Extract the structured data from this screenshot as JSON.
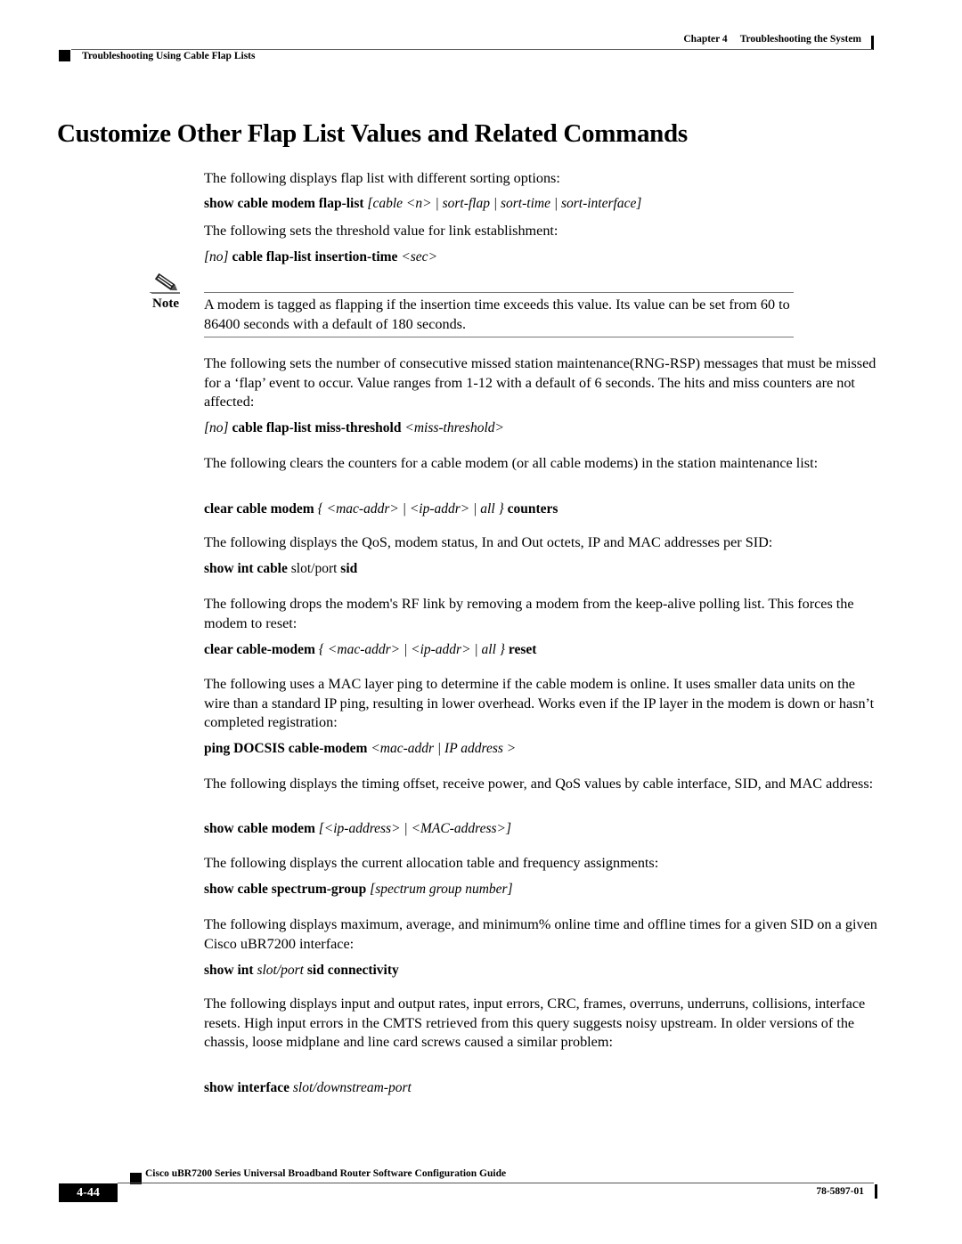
{
  "header": {
    "chapter_label": "Chapter 4",
    "chapter_title": "Troubleshooting the System",
    "section": "Troubleshooting Using Cable Flap Lists"
  },
  "title": "Customize Other Flap List Values and Related Commands",
  "blocks": {
    "p1": "The following displays flap list with different sorting options:",
    "cmd1": {
      "bold": "show cable modem flap-list",
      "italic": "[cable <n> | sort-flap | sort-time | sort-interface]"
    },
    "p2": "The following sets the threshold value for link establishment:",
    "cmd2": {
      "italic_prefix": "[no]",
      "bold": "cable flap-list insertion-time",
      "italic": "<sec>"
    },
    "note": {
      "label": "Note",
      "icon": "pencil-note-icon",
      "text": "A modem is tagged as flapping if the insertion time exceeds this value. Its value can be set from 60 to 86400 seconds with a default of 180 seconds."
    },
    "p3": "The following sets the number of consecutive missed station maintenance(RNG-RSP) messages that must be missed for a ‘flap’ event to occur. Value ranges from 1-12 with a default of 6 seconds. The hits and miss counters are not affected:",
    "cmd3": {
      "italic_prefix": "[no]",
      "bold": "cable flap-list miss-threshold",
      "italic": "<miss-threshold>"
    },
    "p4": "The following clears the counters for a cable modem (or all cable modems) in the station maintenance list:",
    "cmd4": {
      "bold": "clear cable modem",
      "italic": "{ <mac-addr> | <ip-addr> | all }",
      "bold_suffix": "counters"
    },
    "p5": "The following displays the QoS, modem status, In and Out octets, IP and MAC addresses per SID:",
    "cmd5": {
      "bold": "show int cable",
      "plain": "slot/port",
      "bold_suffix": "sid"
    },
    "p6": "The following drops the modem's RF link by removing a modem from the keep-alive polling list. This forces the modem to reset:",
    "cmd6": {
      "bold": "clear cable-modem",
      "italic": "{ <mac-addr> | <ip-addr> | all }",
      "bold_suffix": "reset"
    },
    "p7": "The following uses a MAC layer ping to determine if the cable modem is online. It uses smaller data units on the wire than a standard IP ping, resulting in lower overhead. Works even if the IP layer in the modem is down or hasn’t completed registration:",
    "cmd7": {
      "bold": "ping DOCSIS cable-modem",
      "italic": "<mac-addr | IP address >"
    },
    "p8": "The following displays the timing offset, receive power, and QoS values by cable interface, SID, and MAC address:",
    "cmd8": {
      "bold": "show cable modem",
      "italic": "[<ip-address> | <MAC-address>]"
    },
    "p9": "The following displays the current allocation table and frequency assignments:",
    "cmd9": {
      "bold": "show cable spectrum-group",
      "italic": "[spectrum group number]"
    },
    "p10": "The following displays maximum, average, and minimum% online time and offline times for a given SID on a given Cisco uBR7200 interface:",
    "cmd10": {
      "bold": "show int",
      "italic": "slot/port",
      "bold_suffix": "sid connectivity"
    },
    "p11": "The following displays input and output rates, input errors, CRC, frames, overruns, underruns, collisions, interface resets. High input errors in the CMTS retrieved from this query suggests noisy upstream. In older versions of the chassis, loose midplane and line card screws caused a similar problem:",
    "cmd11": {
      "bold": "show interface",
      "italic": "slot/downstream-port"
    }
  },
  "footer": {
    "guide_title": "Cisco uBR7200 Series Universal Broadband Router Software Configuration Guide",
    "page_number": "4-44",
    "doc_number": "78-5897-01"
  }
}
